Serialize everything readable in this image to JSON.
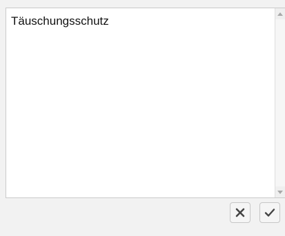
{
  "editor": {
    "text_value": "Täuschungsschutz"
  },
  "actions": {
    "cancel_icon": "close-icon",
    "confirm_icon": "checkmark-icon"
  },
  "colors": {
    "background": "#f2f2f2",
    "text_area_background": "#ffffff",
    "border": "#c9c9c9",
    "icon": "#444444"
  }
}
